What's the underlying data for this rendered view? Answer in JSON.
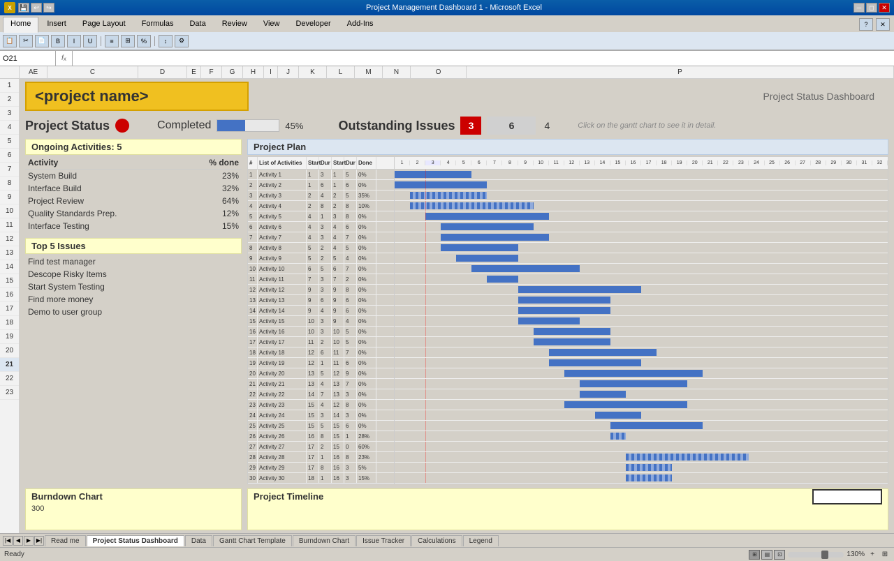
{
  "window": {
    "title": "Project Management Dashboard 1 - Microsoft Excel",
    "controls": [
      "minimize",
      "restore",
      "close"
    ]
  },
  "ribbon": {
    "tabs": [
      "Home",
      "Insert",
      "Page Layout",
      "Formulas",
      "Data",
      "Review",
      "View",
      "Developer",
      "Add-Ins"
    ],
    "active_tab": "Home"
  },
  "formula_bar": {
    "cell_ref": "O21",
    "formula": ""
  },
  "columns": [
    "AE",
    "C",
    "D",
    "E",
    "F",
    "G",
    "H",
    "I",
    "J",
    "K",
    "L",
    "M",
    "N",
    "O",
    "P",
    "C"
  ],
  "dashboard": {
    "project_name": "<project name>",
    "subtitle": "Project Status Dashboard",
    "status": {
      "label": "Project Status",
      "color": "#cc0000"
    },
    "completed": {
      "label": "Completed",
      "pct": 45,
      "pct_label": "45%"
    },
    "issues": {
      "label": "Outstanding Issues",
      "red_count": "3",
      "gray_count": "6",
      "extra": "4"
    },
    "gantt_hint": "Click on the gantt chart to see it in detail.",
    "ongoing": {
      "label": "Ongoing Activities: 5"
    },
    "activities_header": "Activity",
    "pct_done_header": "% done",
    "activities": [
      {
        "name": "System Build",
        "pct": "23%"
      },
      {
        "name": "Interface Build",
        "pct": "32%"
      },
      {
        "name": "Project Review",
        "pct": "64%"
      },
      {
        "name": "Quality Standards Prep.",
        "pct": "12%"
      },
      {
        "name": "Interface Testing",
        "pct": "15%"
      }
    ],
    "top_issues_label": "Top 5 Issues",
    "issues_list": [
      "Find test manager",
      "Descope Risky Items",
      "Start System Testing",
      "Find more money",
      "Demo to user group"
    ],
    "project_plan_label": "Project Plan",
    "gantt_col_headers": [
      "#",
      "List of Activities",
      "Start",
      "Dur",
      "Start",
      "Dur",
      "Done"
    ],
    "gantt_rows": [
      [
        1,
        "Activity 1",
        1,
        3,
        1,
        5,
        "0%"
      ],
      [
        2,
        "Activity 2",
        1,
        6,
        1,
        6,
        "0%"
      ],
      [
        3,
        "Activity 3",
        2,
        4,
        2,
        5,
        "35%"
      ],
      [
        4,
        "Activity 4",
        2,
        8,
        2,
        8,
        "10%"
      ],
      [
        5,
        "Activity 5",
        4,
        1,
        3,
        8,
        "0%"
      ],
      [
        6,
        "Activity 6",
        4,
        3,
        4,
        6,
        "0%"
      ],
      [
        7,
        "Activity 7",
        4,
        3,
        4,
        7,
        "0%"
      ],
      [
        8,
        "Activity 8",
        5,
        2,
        4,
        5,
        "0%"
      ],
      [
        9,
        "Activity 9",
        5,
        2,
        5,
        4,
        "0%"
      ],
      [
        10,
        "Activity 10",
        6,
        5,
        6,
        7,
        "0%"
      ],
      [
        11,
        "Activity 11",
        7,
        3,
        7,
        2,
        "0%"
      ],
      [
        12,
        "Activity 12",
        9,
        3,
        9,
        8,
        "0%"
      ],
      [
        13,
        "Activity 13",
        9,
        6,
        9,
        6,
        "0%"
      ],
      [
        14,
        "Activity 14",
        9,
        4,
        9,
        6,
        "0%"
      ],
      [
        15,
        "Activity 15",
        10,
        3,
        9,
        4,
        "0%"
      ],
      [
        16,
        "Activity 16",
        10,
        3,
        10,
        5,
        "0%"
      ],
      [
        17,
        "Activity 17",
        11,
        2,
        10,
        5,
        "0%"
      ],
      [
        18,
        "Activity 18",
        12,
        6,
        11,
        7,
        "0%"
      ],
      [
        19,
        "Activity 19",
        12,
        1,
        11,
        6,
        "0%"
      ],
      [
        20,
        "Activity 20",
        13,
        5,
        12,
        9,
        "0%"
      ],
      [
        21,
        "Activity 21",
        13,
        4,
        13,
        7,
        "0%"
      ],
      [
        22,
        "Activity 22",
        14,
        7,
        13,
        3,
        "0%"
      ],
      [
        23,
        "Activity 23",
        15,
        4,
        12,
        8,
        "0%"
      ],
      [
        24,
        "Activity 24",
        15,
        3,
        14,
        3,
        "0%"
      ],
      [
        25,
        "Activity 25",
        15,
        5,
        15,
        6,
        "0%"
      ],
      [
        26,
        "Activity 26",
        16,
        8,
        15,
        1,
        "28%"
      ],
      [
        27,
        "Activity 27",
        17,
        2,
        15,
        0,
        "60%"
      ],
      [
        28,
        "Activity 28",
        17,
        1,
        16,
        8,
        "23%"
      ],
      [
        29,
        "Activity 29",
        17,
        8,
        16,
        3,
        "5%"
      ],
      [
        30,
        "Activity 30",
        18,
        1,
        16,
        3,
        "15%"
      ]
    ],
    "week_labels": [
      "1",
      "2",
      "3",
      "4",
      "5",
      "6",
      "7",
      "8",
      "9",
      "10",
      "11",
      "12",
      "13",
      "14",
      "15",
      "16",
      "17",
      "18",
      "19",
      "20",
      "21",
      "22",
      "23",
      "24",
      "25",
      "26",
      "27",
      "28",
      "29",
      "30",
      "31",
      "32"
    ],
    "burndown": {
      "label": "Burndown Chart",
      "value": "300"
    },
    "timeline": {
      "label": "Project Timeline"
    }
  },
  "sheet_tabs": [
    {
      "label": "Read me",
      "active": false
    },
    {
      "label": "Project Status Dashboard",
      "active": true
    },
    {
      "label": "Data",
      "active": false
    },
    {
      "label": "Gantt Chart Template",
      "active": false
    },
    {
      "label": "Burndown Chart",
      "active": false
    },
    {
      "label": "Issue Tracker",
      "active": false
    },
    {
      "label": "Calculations",
      "active": false
    },
    {
      "label": "Legend",
      "active": false
    }
  ],
  "status_bar": {
    "state": "Ready",
    "zoom": "130%"
  }
}
